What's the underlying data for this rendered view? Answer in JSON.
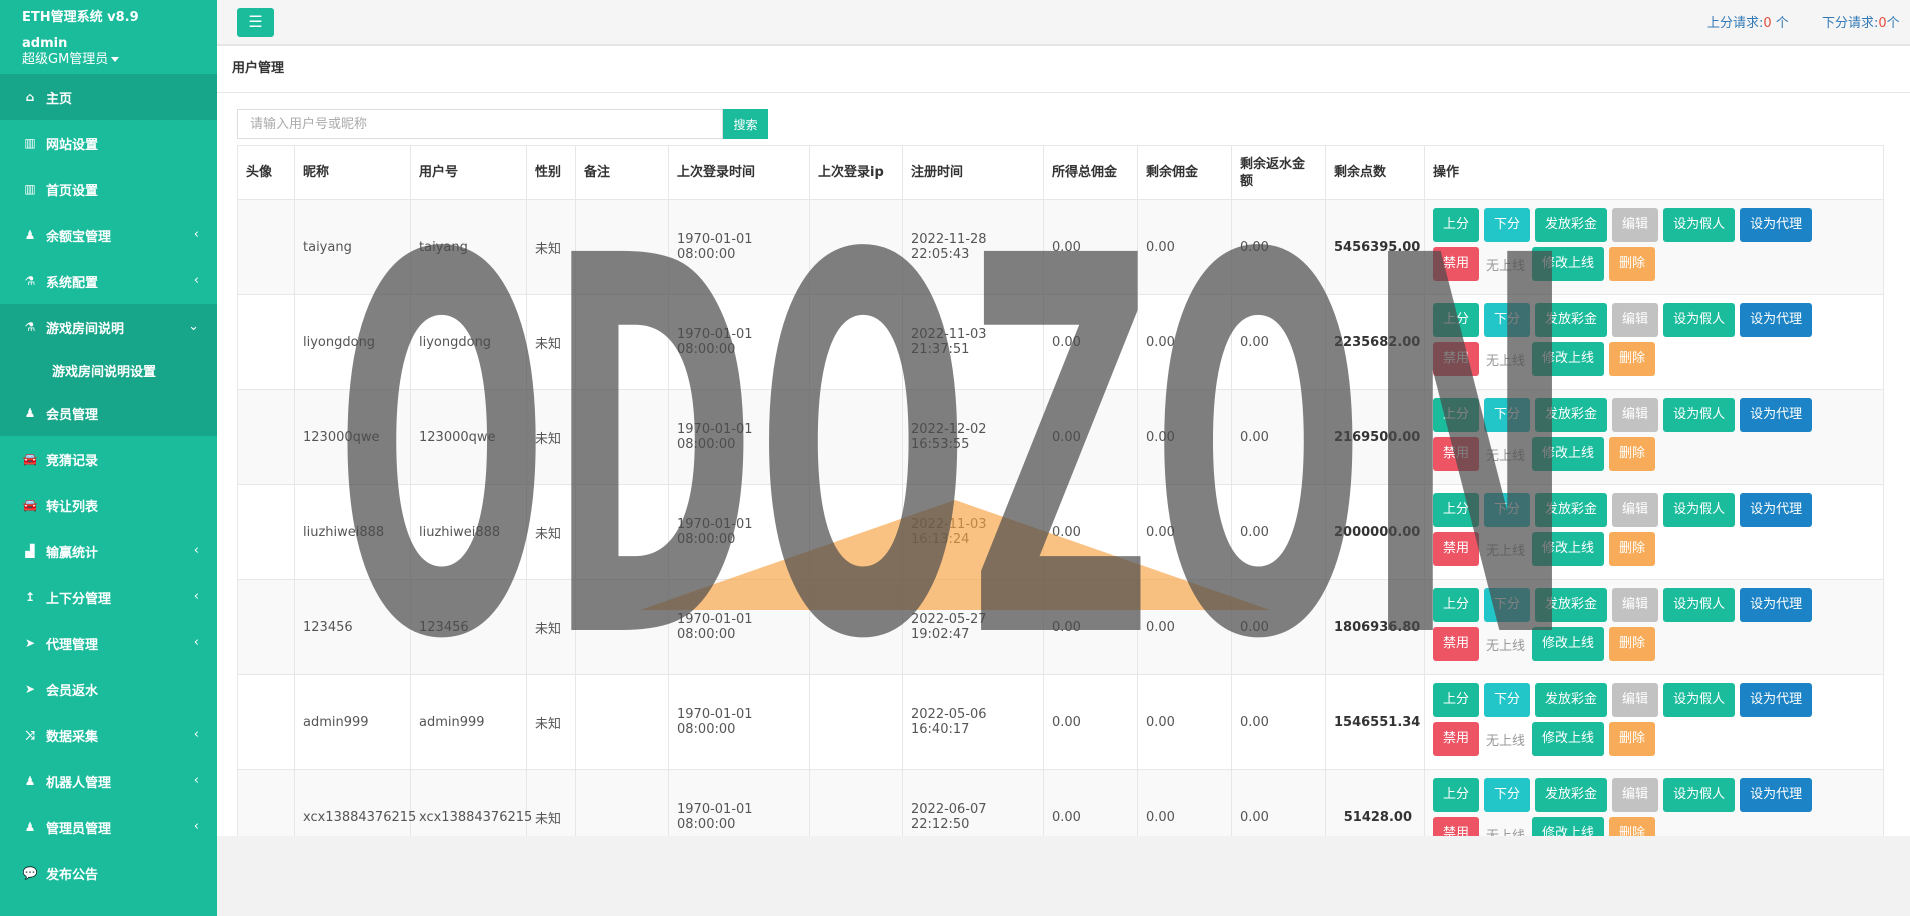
{
  "brand": {
    "title": "ETH管理系统 v8.9",
    "user": "admin",
    "role": "超级GM管理员"
  },
  "sidebar": {
    "items": [
      {
        "label": "主页",
        "icon": "home-icon",
        "glyph": "⌂",
        "has_sub": false
      },
      {
        "label": "网站设置",
        "icon": "columns-icon",
        "glyph": "▥",
        "has_sub": false
      },
      {
        "label": "首页设置",
        "icon": "columns-icon",
        "glyph": "▥",
        "has_sub": false
      },
      {
        "label": "余额宝管理",
        "icon": "male-icon",
        "glyph": "♟",
        "has_sub": true
      },
      {
        "label": "系统配置",
        "icon": "flask-icon",
        "glyph": "⚗",
        "has_sub": true
      },
      {
        "label": "游戏房间说明",
        "icon": "flask-icon",
        "glyph": "⚗",
        "has_sub": true,
        "open": true
      },
      {
        "label": "会员管理",
        "icon": "user-icon",
        "glyph": "♟",
        "has_sub": false
      },
      {
        "label": "竞猜记录",
        "icon": "car-icon",
        "glyph": "🚘",
        "has_sub": false
      },
      {
        "label": "转让列表",
        "icon": "car-icon",
        "glyph": "🚘",
        "has_sub": false
      },
      {
        "label": "输赢统计",
        "icon": "bar-chart-icon",
        "glyph": "▟",
        "has_sub": true
      },
      {
        "label": "上下分管理",
        "icon": "level-up-icon",
        "glyph": "↥",
        "has_sub": true
      },
      {
        "label": "代理管理",
        "icon": "paper-plane-icon",
        "glyph": "➤",
        "has_sub": true
      },
      {
        "label": "会员返水",
        "icon": "paper-plane-icon",
        "glyph": "➤",
        "has_sub": false
      },
      {
        "label": "数据采集",
        "icon": "random-icon",
        "glyph": "⤨",
        "has_sub": true
      },
      {
        "label": "机器人管理",
        "icon": "male-icon",
        "glyph": "♟",
        "has_sub": true
      },
      {
        "label": "管理员管理",
        "icon": "male-icon",
        "glyph": "♟",
        "has_sub": true
      },
      {
        "label": "发布公告",
        "icon": "comment-icon",
        "glyph": "💬",
        "has_sub": false
      }
    ],
    "sub_item": "游戏房间说明设置"
  },
  "topbar": {
    "up_label": "上分请求:",
    "up_count": "0",
    "up_unit": " 个",
    "down_label": "下分请求:",
    "down_count": "0",
    "down_unit": "个"
  },
  "main": {
    "title": "用户管理",
    "search_placeholder": "请输入用户号或昵称",
    "search_btn": "搜索",
    "columns": [
      "头像",
      "昵称",
      "用户号",
      "性别",
      "备注",
      "上次登录时间",
      "上次登录ip",
      "注册时间",
      "所得总佣金",
      "剩余佣金",
      "剩余返水金额",
      "剩余点数",
      "操作"
    ],
    "rows": [
      {
        "nick": "taiyang",
        "uid": "taiyang",
        "gender": "未知",
        "note": "",
        "last_login": "1970-01-01 08:00:00",
        "ip": "",
        "reg": "2022-11-28 22:05:43",
        "total": "0.00",
        "remain": "0.00",
        "rebate": "0.00",
        "points": "5456395.00"
      },
      {
        "nick": "liyongdong",
        "uid": "liyongdong",
        "gender": "未知",
        "note": "",
        "last_login": "1970-01-01 08:00:00",
        "ip": "",
        "reg": "2022-11-03 21:37:51",
        "total": "0.00",
        "remain": "0.00",
        "rebate": "0.00",
        "points": "2235682.00"
      },
      {
        "nick": "123000qwe",
        "uid": "123000qwe",
        "gender": "未知",
        "note": "",
        "last_login": "1970-01-01 08:00:00",
        "ip": "",
        "reg": "2022-12-02 16:53:55",
        "total": "0.00",
        "remain": "0.00",
        "rebate": "0.00",
        "points": "2169500.00"
      },
      {
        "nick": "liuzhiwei888",
        "uid": "liuzhiwei888",
        "gender": "未知",
        "note": "",
        "last_login": "1970-01-01 08:00:00",
        "ip": "",
        "reg": "2022-11-03 16:13:24",
        "total": "0.00",
        "remain": "0.00",
        "rebate": "0.00",
        "points": "2000000.00"
      },
      {
        "nick": "123456",
        "uid": "123456",
        "gender": "未知",
        "note": "",
        "last_login": "1970-01-01 08:00:00",
        "ip": "",
        "reg": "2022-05-27 19:02:47",
        "total": "0.00",
        "remain": "0.00",
        "rebate": "0.00",
        "points": "1806936.80"
      },
      {
        "nick": "admin999",
        "uid": "admin999",
        "gender": "未知",
        "note": "",
        "last_login": "1970-01-01 08:00:00",
        "ip": "",
        "reg": "2022-05-06 16:40:17",
        "total": "0.00",
        "remain": "0.00",
        "rebate": "0.00",
        "points": "1546551.34"
      },
      {
        "nick": "xcx13884376215",
        "uid": "xcx13884376215",
        "gender": "未知",
        "note": "",
        "last_login": "1970-01-01 08:00:00",
        "ip": "",
        "reg": "2022-06-07 22:12:50",
        "total": "0.00",
        "remain": "0.00",
        "rebate": "0.00",
        "points": "51428.00"
      }
    ],
    "ops": {
      "up": "上分",
      "down": "下分",
      "bonus": "发放彩金",
      "edit": "编辑",
      "fake": "设为假人",
      "agent": "设为代理",
      "ban": "禁用",
      "no_parent": "无上线",
      "change_parent": "修改上线",
      "delete": "删除"
    }
  },
  "watermark": {
    "text": "ODOZON"
  },
  "colors": {
    "accent": "#1abc9c",
    "danger": "#ed5565",
    "warning": "#f8ac59",
    "info": "#23c6c8",
    "blue": "#1c84c6"
  }
}
